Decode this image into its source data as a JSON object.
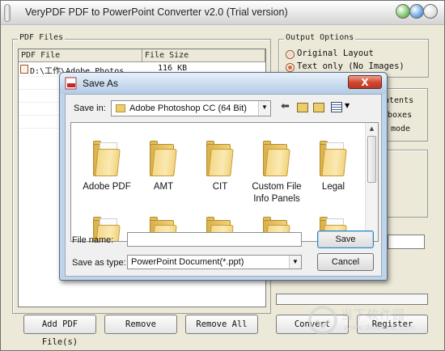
{
  "window": {
    "title": "VeryPDF PDF to PowerPoint Converter v2.0 (Trial version)"
  },
  "pdf_files": {
    "group_label": "PDF Files",
    "columns": [
      "PDF File",
      "File Size"
    ],
    "rows": [
      {
        "file": "D:\\工作\\Adobe Photos...",
        "size": "116 KB"
      }
    ]
  },
  "buttons": {
    "add": "Add PDF File(s)",
    "remove": "Remove",
    "remove_all": "Remove All",
    "convert": "Convert",
    "register": "Register"
  },
  "output_options": {
    "group_label": "Output Options",
    "options": [
      {
        "label": "Original Layout",
        "selected": false
      },
      {
        "label": "Text only (No Images)",
        "selected": true
      }
    ],
    "partial_texts": [
      "ntents",
      "boxes",
      "mode"
    ]
  },
  "save_as": {
    "title": "Save As",
    "save_in_label": "Save in:",
    "save_in_value": "Adobe Photoshop CC (64 Bit)",
    "items_row1": [
      "Adobe PDF",
      "AMT",
      "CIT",
      "Custom File Info Panels",
      "Legal"
    ],
    "file_name_label": "File name:",
    "file_name_value": "",
    "save_type_label": "Save as type:",
    "save_type_value": "PowerPoint Document(*.ppt)",
    "save_label": "Save",
    "cancel_label": "Cancel",
    "close_glyph": "X"
  },
  "watermark": {
    "text": "当下软件园",
    "sub": "www.downxia.com"
  },
  "colors": {
    "accent_radio": "#d96a2c",
    "dialog_frame": "#bfd4ea",
    "folder": "#f4d98a"
  }
}
